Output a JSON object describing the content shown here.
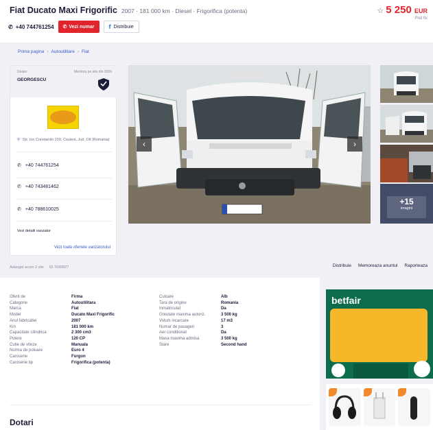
{
  "header": {
    "title": "Fiat Ducato Maxi Frigorific",
    "specs": "2007 · 181 000 km · Diesel · Frigorifica (potenta)",
    "price": "5 250",
    "price_currency": "EUR",
    "price_note": "Pret fix",
    "phone": "+40 744761254",
    "call_button": "Vezi numar",
    "share_button": "Distribuie"
  },
  "breadcrumb": [
    "Prima pagina",
    "Autoutilitare",
    "Fiat"
  ],
  "dealer": {
    "label": "Dealer",
    "since": "Membru pe site din 2006",
    "name": "GEORGESCU",
    "address": "Str. Ion Constantin 210, Cezieni, Jud. Olt (Romania)",
    "phones": [
      "+40 744761254",
      "+40 743481462",
      "+40 788610025"
    ],
    "more_label": "Vezi detalii vanzator",
    "all_ads_link": "Vezi toate ofertele vanzatorului"
  },
  "gallery": {
    "more_count": "+15",
    "more_label": "imagini"
  },
  "meta": {
    "left_items": [
      "Adaugat acum 2 zile",
      "ID 7030827"
    ],
    "right_items": [
      "Distribuie",
      "Memoreaza anuntul",
      "Raporteaza"
    ]
  },
  "specs_left": [
    {
      "k": "Oferit de",
      "v": "Firma"
    },
    {
      "k": "Categorie",
      "v": "Autoutilitara"
    },
    {
      "k": "Marca",
      "v": "Fiat"
    },
    {
      "k": "Model",
      "v": "Ducato Maxi Frigorific"
    },
    {
      "k": "Anul fabricatiei",
      "v": "2007"
    },
    {
      "k": "Km",
      "v": "181 000 km"
    },
    {
      "k": "Capacitate cilindrica",
      "v": "2 300 cm3"
    },
    {
      "k": "Putere",
      "v": "120 CP"
    },
    {
      "k": "Cutie de viteze",
      "v": "Manuala"
    },
    {
      "k": "Norma de poluare",
      "v": "Euro 4"
    },
    {
      "k": "Caroserie",
      "v": "Furgon"
    },
    {
      "k": "Caroserie tip",
      "v": "Frigorifica (potenta)"
    }
  ],
  "specs_right": [
    {
      "k": "Culoare",
      "v": "Alb"
    },
    {
      "k": "Tara de origine",
      "v": "Romania"
    },
    {
      "k": "Inmatriculat",
      "v": "Da"
    },
    {
      "k": "Greutate maxima autoriz.",
      "v": "3 500 kg"
    },
    {
      "k": "Volum incarcare",
      "v": "17 m3"
    },
    {
      "k": "Numar de pasageri",
      "v": "3"
    },
    {
      "k": "Aer conditionat",
      "v": "Da"
    },
    {
      "k": "Masa maxima admisa",
      "v": "3 500 kg"
    },
    {
      "k": "Stare",
      "v": "Second hand"
    }
  ],
  "section_title": "Dotari",
  "ad": {
    "brand": "betfair"
  },
  "colors": {
    "accent_red": "#e2242c",
    "link_blue": "#3a58c8",
    "ad_green": "#0d6b4e",
    "ad_yellow": "#f6b728"
  }
}
